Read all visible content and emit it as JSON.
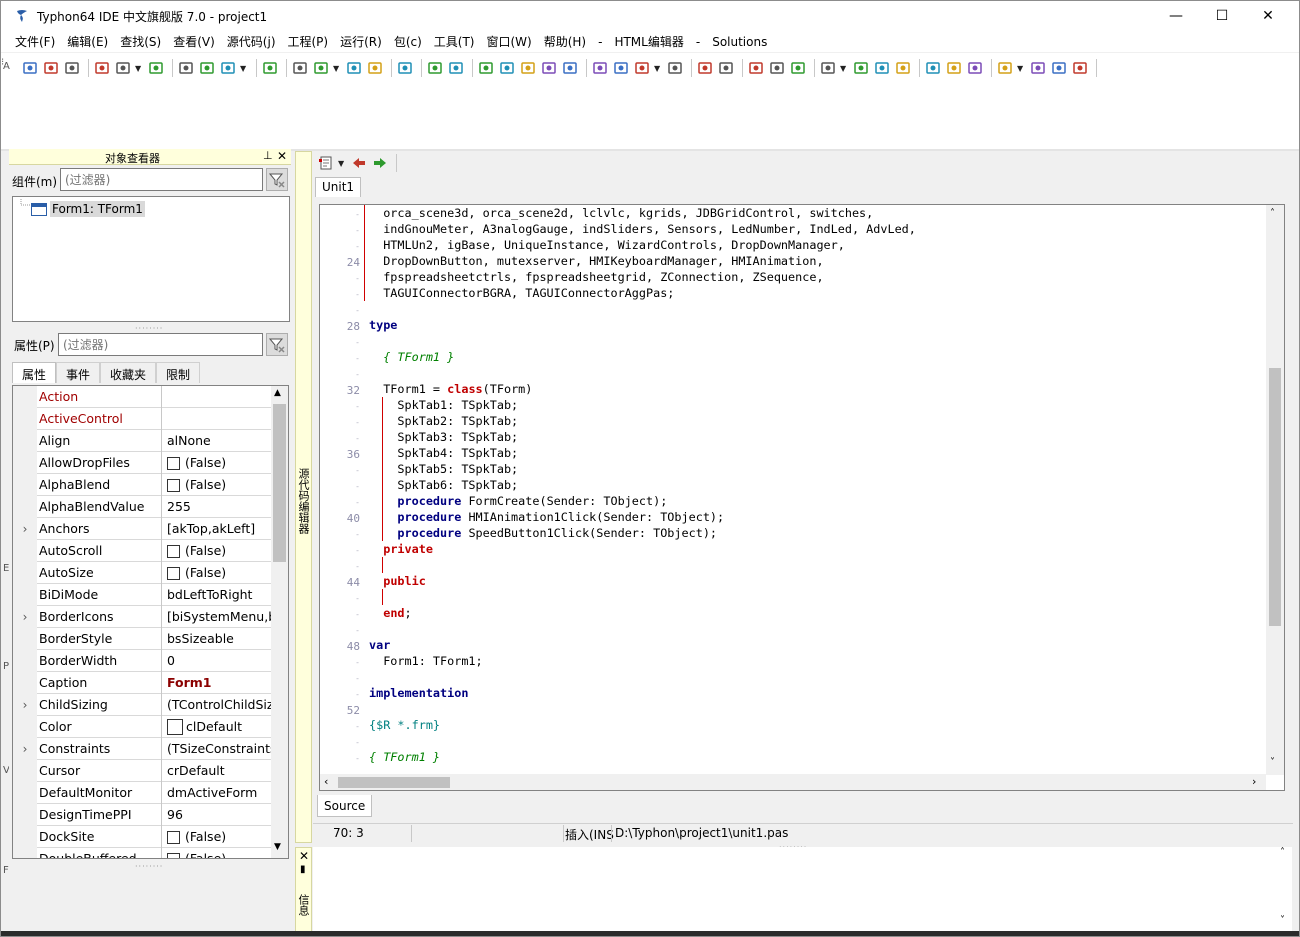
{
  "window": {
    "title": "Typhon64 IDE 中文旗舰版 7.0 - project1",
    "minimize": "—",
    "maximize": "☐",
    "close": "✕"
  },
  "menu": [
    "文件(F)",
    "编辑(E)",
    "查找(S)",
    "查看(V)",
    "源代码(j)",
    "工程(P)",
    "运行(R)",
    "包(c)",
    "工具(T)",
    "窗口(W)",
    "帮助(H)",
    "-",
    "HTML编辑器",
    "-",
    "Solutions"
  ],
  "object_inspector": {
    "title": "对象查看器",
    "components_label": "组件(m)",
    "filter_placeholder": "(过滤器)",
    "tree_item": "Form1: TForm1",
    "properties_label": "属性(P)",
    "tabs": [
      "属性",
      "事件",
      "收藏夹",
      "限制"
    ],
    "properties": [
      {
        "name": "Action",
        "value": "",
        "style": "red"
      },
      {
        "name": "ActiveControl",
        "value": "",
        "style": "red"
      },
      {
        "name": "Align",
        "value": "alNone"
      },
      {
        "name": "AllowDropFiles",
        "value": "(False)",
        "checkbox": true
      },
      {
        "name": "AlphaBlend",
        "value": "(False)",
        "checkbox": true
      },
      {
        "name": "AlphaBlendValue",
        "value": "255"
      },
      {
        "name": "Anchors",
        "value": "[akTop,akLeft]",
        "expand": true
      },
      {
        "name": "AutoScroll",
        "value": "(False)",
        "checkbox": true
      },
      {
        "name": "AutoSize",
        "value": "(False)",
        "checkbox": true
      },
      {
        "name": "BiDiMode",
        "value": "bdLeftToRight"
      },
      {
        "name": "BorderIcons",
        "value": "[biSystemMenu,bi",
        "expand": true
      },
      {
        "name": "BorderStyle",
        "value": "bsSizeable"
      },
      {
        "name": "BorderWidth",
        "value": "0"
      },
      {
        "name": "Caption",
        "value": "Form1",
        "bold": true
      },
      {
        "name": "ChildSizing",
        "value": "(TControlChildSizi",
        "expand": true
      },
      {
        "name": "Color",
        "value": "clDefault",
        "color": true
      },
      {
        "name": "Constraints",
        "value": "(TSizeConstraints)",
        "expand": true
      },
      {
        "name": "Cursor",
        "value": "crDefault"
      },
      {
        "name": "DefaultMonitor",
        "value": "dmActiveForm"
      },
      {
        "name": "DesignTimePPI",
        "value": "96"
      },
      {
        "name": "DockSite",
        "value": "(False)",
        "checkbox": true
      },
      {
        "name": "DoubleBuffered",
        "value": "(False)",
        "checkbox": true
      }
    ]
  },
  "source_editor": {
    "dock_label": "源代码编辑器",
    "file_tab": "Unit1",
    "bottom_tab": "Source",
    "gutter": [
      "",
      "",
      "",
      "24",
      "",
      "",
      "",
      "28",
      "",
      "",
      "",
      "32",
      "",
      "",
      "",
      "36",
      "",
      "",
      "",
      "40",
      "",
      "",
      "",
      "44",
      "",
      "",
      "",
      "48",
      "",
      "",
      "",
      "52",
      "",
      "",
      ""
    ],
    "lines": [
      "  orca_scene3d, orca_scene2d, lclvlc, kgrids, JDBGridControl, switches,",
      "  indGnouMeter, A3nalogGauge, indSliders, Sensors, LedNumber, IndLed, AdvLed,",
      "  HTMLUn2, igBase, UniqueInstance, WizardControls, DropDownManager,",
      "  DropDownButton, mutexserver, HMIKeyboardManager, HMIAnimation,",
      "  fpspreadsheetctrls, fpspreadsheetgrid, ZConnection, ZSequence,",
      "  TAGUIConnectorBGRA, TAGUIConnectorAggPas;",
      "",
      "type",
      "",
      "  { TForm1 }",
      "",
      "  TForm1 = class(TForm)",
      "    SpkTab1: TSpkTab;",
      "    SpkTab2: TSpkTab;",
      "    SpkTab3: TSpkTab;",
      "    SpkTab4: TSpkTab;",
      "    SpkTab5: TSpkTab;",
      "    SpkTab6: TSpkTab;",
      "    procedure FormCreate(Sender: TObject);",
      "    procedure HMIAnimation1Click(Sender: TObject);",
      "    procedure SpeedButton1Click(Sender: TObject);",
      "  private",
      "",
      "  public",
      "",
      "  end;",
      "",
      "var",
      "  Form1: TForm1;",
      "",
      "implementation",
      "",
      "{$R *.frm}",
      "",
      "{ TForm1 }"
    ]
  },
  "status": {
    "position": "70:  3",
    "mode": "插入(INS",
    "file": "D:\\Typhon\\project1\\unit1.pas"
  },
  "messages": {
    "dock_label": "信息"
  }
}
